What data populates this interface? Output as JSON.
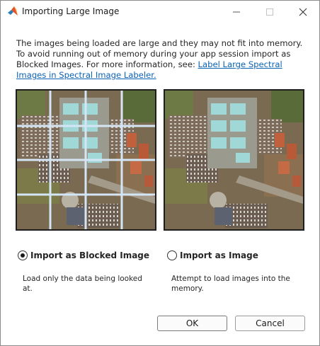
{
  "window": {
    "title": "Importing Large Image"
  },
  "icons": {
    "app": "matlab-logo-icon",
    "minimize": "minimize-icon",
    "maximize": "maximize-icon",
    "close": "close-icon"
  },
  "message": {
    "text": "The images being loaded are large and they may not fit into memory. To avoid running out of memory during your app session import as Blocked Images. For more information, see: ",
    "link_text": "Label Large Spectral Images in Spectral Image Labeler."
  },
  "options": {
    "blocked": {
      "label": "Import as Blocked Image",
      "description": "Load only the data being looked at.",
      "selected": true
    },
    "image": {
      "label": "Import as Image",
      "description": "Attempt to load images into the memory.",
      "selected": false
    }
  },
  "buttons": {
    "ok": "OK",
    "cancel": "Cancel"
  },
  "colors": {
    "link": "#0b63b5",
    "grid_lines": "#cfe3f5"
  }
}
